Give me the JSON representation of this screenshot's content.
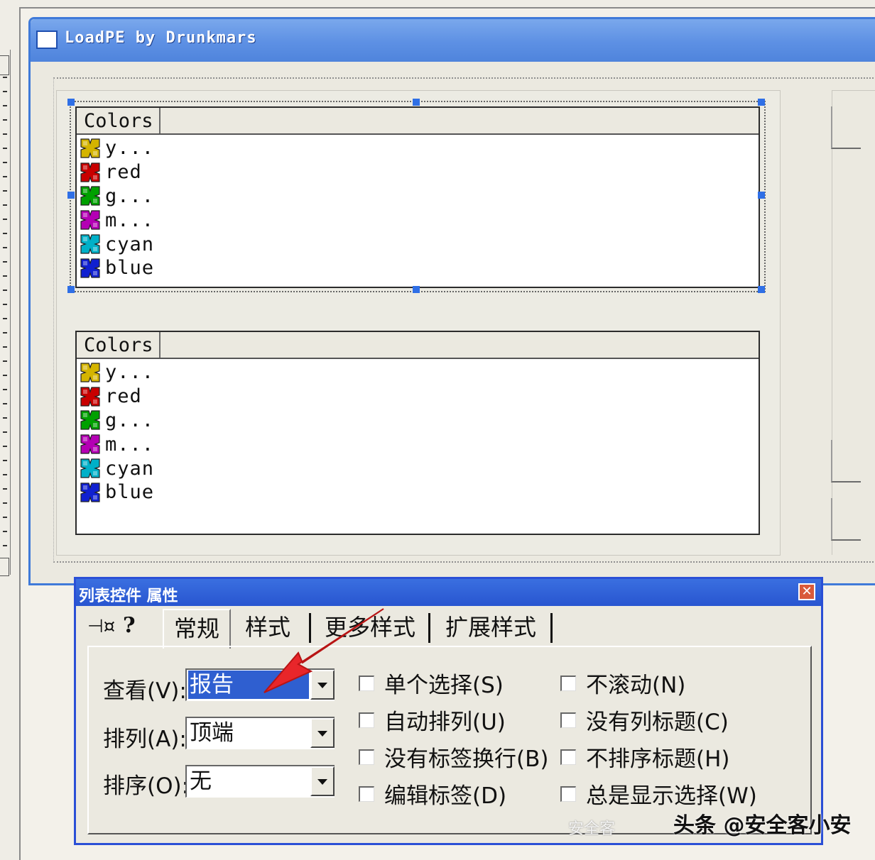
{
  "window": {
    "title": "LoadPE by Drunkmars"
  },
  "listviews": [
    {
      "column_header": "Colors",
      "items": [
        {
          "label": "y...",
          "color": "#d4b400"
        },
        {
          "label": "red",
          "color": "#c80000"
        },
        {
          "label": "g...",
          "color": "#00a000"
        },
        {
          "label": "m...",
          "color": "#b400b4"
        },
        {
          "label": "cyan",
          "color": "#00b0c8"
        },
        {
          "label": "blue",
          "color": "#1020d0"
        }
      ]
    },
    {
      "column_header": "Colors",
      "items": [
        {
          "label": "y...",
          "color": "#d4b400"
        },
        {
          "label": "red",
          "color": "#c80000"
        },
        {
          "label": "g...",
          "color": "#00a000"
        },
        {
          "label": "m...",
          "color": "#b400b4"
        },
        {
          "label": "cyan",
          "color": "#00b0c8"
        },
        {
          "label": "blue",
          "color": "#1020d0"
        }
      ]
    }
  ],
  "properties": {
    "title": "列表控件 属性",
    "close_glyph": "✕",
    "pin_glyph": "⊣¤",
    "help_glyph": "?",
    "tabs": [
      "常规",
      "样式",
      "更多样式",
      "扩展样式"
    ],
    "fields": {
      "view_label": "查看(V):",
      "view_value": "报告",
      "align_label": "排列(A):",
      "align_value": "顶端",
      "sort_label": "排序(O):",
      "sort_value": "无"
    },
    "checkboxes": [
      "单个选择(S)",
      "自动排列(U)",
      "没有标签换行(B)",
      "编辑标签(D)",
      "不滚动(N)",
      "没有列标题(C)",
      "不排序标题(H)",
      "总是显示选择(W)"
    ]
  },
  "watermark": "头条 @安全客小安",
  "watermark_faint": "安全客"
}
